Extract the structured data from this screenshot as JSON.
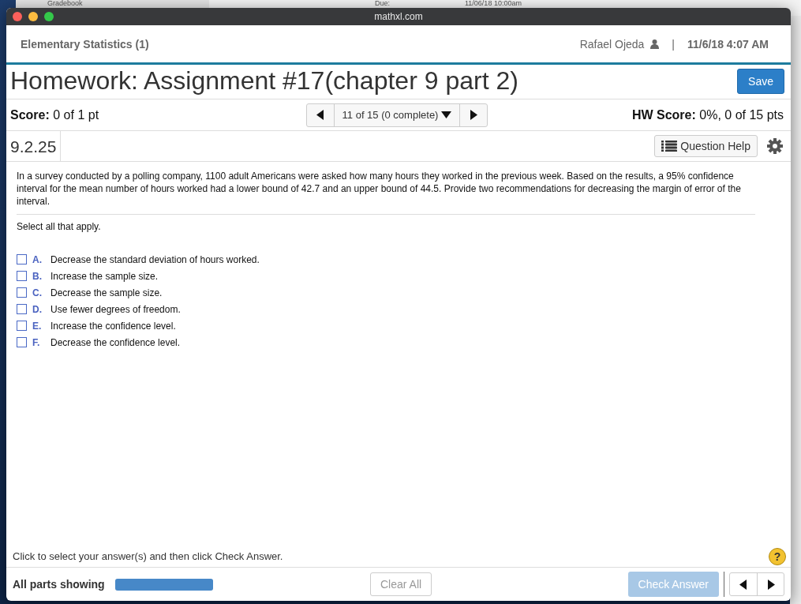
{
  "background": {
    "texts": [
      "Gradebook",
      "Due:",
      "11/06/18 10:00am"
    ]
  },
  "window": {
    "title": "mathxl.com"
  },
  "header": {
    "course": "Elementary Statistics (1)",
    "user": "Rafael Ojeda",
    "separator": "|",
    "datetime": "11/6/18 4:07 AM"
  },
  "assignment": {
    "title": "Homework: Assignment #17(chapter 9 part 2)",
    "save": "Save"
  },
  "score_bar": {
    "score_label": "Score:",
    "score": "0 of 1 pt",
    "question_nav": "11 of 15 (0 complete)",
    "hw_label": "HW Score:",
    "hw_score": "0%, 0 of 15 pts"
  },
  "question_bar": {
    "number": "9.2.25",
    "help": "Question Help"
  },
  "question": {
    "text": "In a survey conducted by a polling company, 1100 adult Americans were asked how many hours they worked in the previous week. Based on the results, a 95% confidence interval for the mean number of hours worked had a lower bound of 42.7 and an upper bound of 44.5. Provide two recommendations for decreasing the margin of error of the interval.",
    "instruction": "Select all that apply.",
    "options": [
      {
        "letter": "A.",
        "text": "Decrease the standard deviation of hours worked.",
        "checked": false
      },
      {
        "letter": "B.",
        "text": "Increase the sample size.",
        "checked": false
      },
      {
        "letter": "C.",
        "text": "Decrease the sample size.",
        "checked": false
      },
      {
        "letter": "D.",
        "text": "Use fewer degrees of freedom.",
        "checked": false
      },
      {
        "letter": "E.",
        "text": "Increase the confidence level.",
        "checked": false
      },
      {
        "letter": "F.",
        "text": "Decrease the confidence level.",
        "checked": false
      }
    ]
  },
  "footer": {
    "hint": "Click to select your answer(s) and then click Check Answer.",
    "help_mark": "?",
    "parts": "All parts showing",
    "progress": {
      "level": 1
    },
    "clear": "Clear All",
    "check": {
      "label": "Check Answer",
      "disabled": true
    }
  }
}
